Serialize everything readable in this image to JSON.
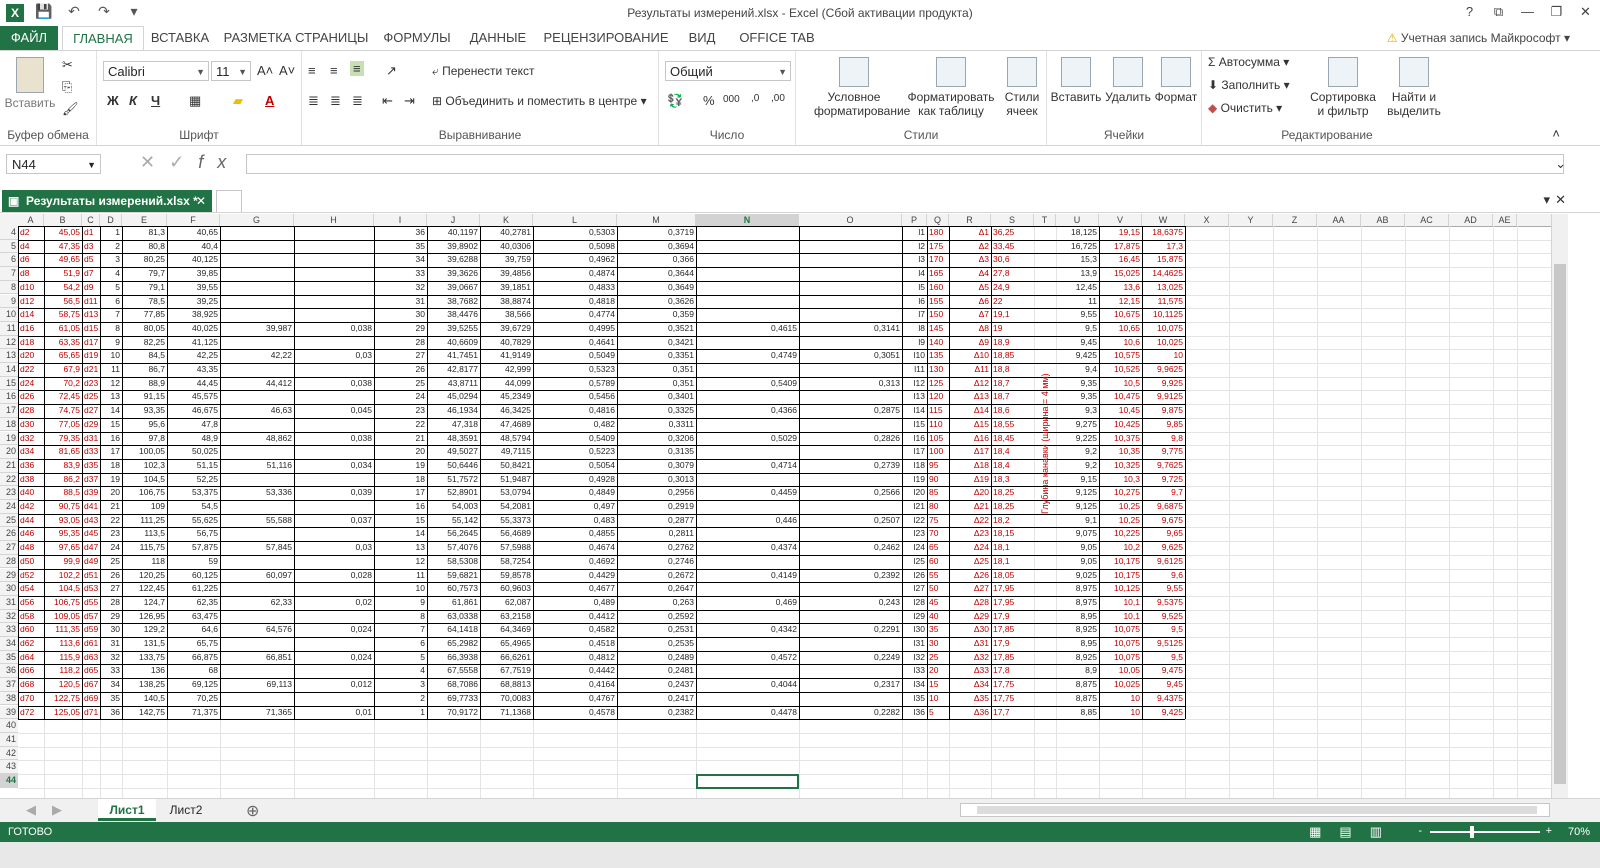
{
  "window": {
    "title": "Результаты измерений.xlsx - Excel (Сбой активации продукта)",
    "app_icon": "X",
    "help": "?",
    "controls": [
      "⧉",
      "—",
      "❐",
      "✕"
    ]
  },
  "qat": [
    "💾",
    "↶",
    "↷",
    "▾"
  ],
  "tabs": {
    "file": "ФАЙЛ",
    "items": [
      "ГЛАВНАЯ",
      "ВСТАВКА",
      "РАЗМЕТКА СТРАНИЦЫ",
      "ФОРМУЛЫ",
      "ДАННЫЕ",
      "РЕЦЕНЗИРОВАНИЕ",
      "ВИД",
      "OFFICE TAB"
    ],
    "account": "Учетная запись Майкрософт"
  },
  "ribbon": {
    "clipboard": {
      "label": "Буфер обмена",
      "paste": "Вставить"
    },
    "font": {
      "label": "Шрифт",
      "name": "Calibri",
      "size": "11",
      "bold": "Ж",
      "italic": "К",
      "underline": "Ч"
    },
    "alignment": {
      "label": "Выравнивание",
      "wrap": "Перенести текст",
      "merge": "Объединить и поместить в центре"
    },
    "number": {
      "label": "Число",
      "format": "Общий",
      "percent": "%",
      "thousands": "000"
    },
    "styles": {
      "label": "Стили",
      "cond": "Условное форматирование",
      "table": "Форматировать как таблицу",
      "cell": "Стили ячеек"
    },
    "cells": {
      "label": "Ячейки",
      "insert": "Вставить",
      "delete": "Удалить",
      "format": "Формат"
    },
    "editing": {
      "label": "Редактирование",
      "autosum": "Автосумма",
      "fill": "Заполнить",
      "clear": "Очистить",
      "sort": "Сортировка и фильтр",
      "find": "Найти и выделить"
    }
  },
  "formula": {
    "namebox": "N44",
    "value": ""
  },
  "doc_tab": "Результаты измерений.xlsx *",
  "columns": [
    "A",
    "B",
    "C",
    "D",
    "E",
    "F",
    "G",
    "H",
    "I",
    "J",
    "K",
    "L",
    "M",
    "N",
    "O",
    "P",
    "Q",
    "R",
    "S",
    "T",
    "U",
    "V",
    "W",
    "X",
    "Y",
    "Z",
    "AA",
    "AB",
    "AC",
    "AD",
    "AE"
  ],
  "selected_column": "N",
  "selected_cell": "N44",
  "vertical_label": "Глубина канавки (ширина = 4 мм)",
  "rows": [
    [
      "4",
      "d2",
      "45,05",
      "d1",
      "1",
      "81,3",
      "40,65",
      "",
      "",
      "36",
      "40,1197",
      "40,2781",
      "0,5303",
      "0,3719",
      "",
      "",
      "l1",
      "180",
      "Δ1",
      "36,25",
      "",
      "18,125",
      "19,15",
      "18,6375"
    ],
    [
      "5",
      "d4",
      "47,35",
      "d3",
      "2",
      "80,8",
      "40,4",
      "",
      "",
      "35",
      "39,8902",
      "40,0306",
      "0,5098",
      "0,3694",
      "",
      "",
      "l2",
      "175",
      "Δ2",
      "33,45",
      "",
      "16,725",
      "17,875",
      "17,3"
    ],
    [
      "6",
      "d6",
      "49,65",
      "d5",
      "3",
      "80,25",
      "40,125",
      "",
      "",
      "34",
      "39,6288",
      "39,759",
      "0,4962",
      "0,366",
      "",
      "",
      "l3",
      "170",
      "Δ3",
      "30,6",
      "",
      "15,3",
      "16,45",
      "15,875"
    ],
    [
      "7",
      "d8",
      "51,9",
      "d7",
      "4",
      "79,7",
      "39,85",
      "",
      "",
      "33",
      "39,3626",
      "39,4856",
      "0,4874",
      "0,3644",
      "",
      "",
      "l4",
      "165",
      "Δ4",
      "27,8",
      "",
      "13,9",
      "15,025",
      "14,4625"
    ],
    [
      "8",
      "d10",
      "54,2",
      "d9",
      "5",
      "79,1",
      "39,55",
      "",
      "",
      "32",
      "39,0667",
      "39,1851",
      "0,4833",
      "0,3649",
      "",
      "",
      "l5",
      "160",
      "Δ5",
      "24,9",
      "",
      "12,45",
      "13,6",
      "13,025"
    ],
    [
      "9",
      "d12",
      "56,5",
      "d11",
      "6",
      "78,5",
      "39,25",
      "",
      "",
      "31",
      "38,7682",
      "38,8874",
      "0,4818",
      "0,3626",
      "",
      "",
      "l6",
      "155",
      "Δ6",
      "22",
      "",
      "11",
      "12,15",
      "11,575"
    ],
    [
      "10",
      "d14",
      "58,75",
      "d13",
      "7",
      "77,85",
      "38,925",
      "",
      "",
      "30",
      "38,4476",
      "38,566",
      "0,4774",
      "0,359",
      "",
      "",
      "l7",
      "150",
      "Δ7",
      "19,1",
      "",
      "9,55",
      "10,675",
      "10,1125"
    ],
    [
      "11",
      "d16",
      "61,05",
      "d15",
      "8",
      "80,05",
      "40,025",
      "39,987",
      "0,038",
      "29",
      "39,5255",
      "39,6729",
      "0,4995",
      "0,3521",
      "0,4615",
      "0,3141",
      "l8",
      "145",
      "Δ8",
      "19",
      "",
      "9,5",
      "10,65",
      "10,075"
    ],
    [
      "12",
      "d18",
      "63,35",
      "d17",
      "9",
      "82,25",
      "41,125",
      "",
      "",
      "28",
      "40,6609",
      "40,7829",
      "0,4641",
      "0,3421",
      "",
      "",
      "l9",
      "140",
      "Δ9",
      "18,9",
      "",
      "9,45",
      "10,6",
      "10,025"
    ],
    [
      "13",
      "d20",
      "65,65",
      "d19",
      "10",
      "84,5",
      "42,25",
      "42,22",
      "0,03",
      "27",
      "41,7451",
      "41,9149",
      "0,5049",
      "0,3351",
      "0,4749",
      "0,3051",
      "l10",
      "135",
      "Δ10",
      "18,85",
      "",
      "9,425",
      "10,575",
      "10"
    ],
    [
      "14",
      "d22",
      "67,9",
      "d21",
      "11",
      "86,7",
      "43,35",
      "",
      "",
      "26",
      "42,8177",
      "42,999",
      "0,5323",
      "0,351",
      "",
      "",
      "l11",
      "130",
      "Δ11",
      "18,8",
      "",
      "9,4",
      "10,525",
      "9,9625"
    ],
    [
      "15",
      "d24",
      "70,2",
      "d23",
      "12",
      "88,9",
      "44,45",
      "44,412",
      "0,038",
      "25",
      "43,8711",
      "44,099",
      "0,5789",
      "0,351",
      "0,5409",
      "0,313",
      "l12",
      "125",
      "Δ12",
      "18,7",
      "",
      "9,35",
      "10,5",
      "9,925"
    ],
    [
      "16",
      "d26",
      "72,45",
      "d25",
      "13",
      "91,15",
      "45,575",
      "",
      "",
      "24",
      "45,0294",
      "45,2349",
      "0,5456",
      "0,3401",
      "",
      "",
      "l13",
      "120",
      "Δ13",
      "18,7",
      "",
      "9,35",
      "10,475",
      "9,9125"
    ],
    [
      "17",
      "d28",
      "74,75",
      "d27",
      "14",
      "93,35",
      "46,675",
      "46,63",
      "0,045",
      "23",
      "46,1934",
      "46,3425",
      "0,4816",
      "0,3325",
      "0,4366",
      "0,2875",
      "l14",
      "115",
      "Δ14",
      "18,6",
      "",
      "9,3",
      "10,45",
      "9,875"
    ],
    [
      "18",
      "d30",
      "77,05",
      "d29",
      "15",
      "95,6",
      "47,8",
      "",
      "",
      "22",
      "47,318",
      "47,4689",
      "0,482",
      "0,3311",
      "",
      "",
      "l15",
      "110",
      "Δ15",
      "18,55",
      "",
      "9,275",
      "10,425",
      "9,85"
    ],
    [
      "19",
      "d32",
      "79,35",
      "d31",
      "16",
      "97,8",
      "48,9",
      "48,862",
      "0,038",
      "21",
      "48,3591",
      "48,5794",
      "0,5409",
      "0,3206",
      "0,5029",
      "0,2826",
      "l16",
      "105",
      "Δ16",
      "18,45",
      "",
      "9,225",
      "10,375",
      "9,8"
    ],
    [
      "20",
      "d34",
      "81,65",
      "d33",
      "17",
      "100,05",
      "50,025",
      "",
      "",
      "20",
      "49,5027",
      "49,7115",
      "0,5223",
      "0,3135",
      "",
      "",
      "l17",
      "100",
      "Δ17",
      "18,4",
      "",
      "9,2",
      "10,35",
      "9,775"
    ],
    [
      "21",
      "d36",
      "83,9",
      "d35",
      "18",
      "102,3",
      "51,15",
      "51,116",
      "0,034",
      "19",
      "50,6446",
      "50,8421",
      "0,5054",
      "0,3079",
      "0,4714",
      "0,2739",
      "l18",
      "95",
      "Δ18",
      "18,4",
      "",
      "9,2",
      "10,325",
      "9,7625"
    ],
    [
      "22",
      "d38",
      "86,2",
      "d37",
      "19",
      "104,5",
      "52,25",
      "",
      "",
      "18",
      "51,7572",
      "51,9487",
      "0,4928",
      "0,3013",
      "",
      "",
      "l19",
      "90",
      "Δ19",
      "18,3",
      "",
      "9,15",
      "10,3",
      "9,725"
    ],
    [
      "23",
      "d40",
      "88,5",
      "d39",
      "20",
      "106,75",
      "53,375",
      "53,336",
      "0,039",
      "17",
      "52,8901",
      "53,0794",
      "0,4849",
      "0,2956",
      "0,4459",
      "0,2566",
      "l20",
      "85",
      "Δ20",
      "18,25",
      "",
      "9,125",
      "10,275",
      "9,7"
    ],
    [
      "24",
      "d42",
      "90,75",
      "d41",
      "21",
      "109",
      "54,5",
      "",
      "",
      "16",
      "54,003",
      "54,2081",
      "0,497",
      "0,2919",
      "",
      "",
      "l21",
      "80",
      "Δ21",
      "18,25",
      "",
      "9,125",
      "10,25",
      "9,6875"
    ],
    [
      "25",
      "d44",
      "93,05",
      "d43",
      "22",
      "111,25",
      "55,625",
      "55,588",
      "0,037",
      "15",
      "55,142",
      "55,3373",
      "0,483",
      "0,2877",
      "0,446",
      "0,2507",
      "l22",
      "75",
      "Δ22",
      "18,2",
      "",
      "9,1",
      "10,25",
      "9,675"
    ],
    [
      "26",
      "d46",
      "95,35",
      "d45",
      "23",
      "113,5",
      "56,75",
      "",
      "",
      "14",
      "56,2645",
      "56,4689",
      "0,4855",
      "0,2811",
      "",
      "",
      "l23",
      "70",
      "Δ23",
      "18,15",
      "",
      "9,075",
      "10,225",
      "9,65"
    ],
    [
      "27",
      "d48",
      "97,65",
      "d47",
      "24",
      "115,75",
      "57,875",
      "57,845",
      "0,03",
      "13",
      "57,4076",
      "57,5988",
      "0,4674",
      "0,2762",
      "0,4374",
      "0,2462",
      "l24",
      "65",
      "Δ24",
      "18,1",
      "",
      "9,05",
      "10,2",
      "9,625"
    ],
    [
      "28",
      "d50",
      "99,9",
      "d49",
      "25",
      "118",
      "59",
      "",
      "",
      "12",
      "58,5308",
      "58,7254",
      "0,4692",
      "0,2746",
      "",
      "",
      "l25",
      "60",
      "Δ25",
      "18,1",
      "",
      "9,05",
      "10,175",
      "9,6125"
    ],
    [
      "29",
      "d52",
      "102,2",
      "d51",
      "26",
      "120,25",
      "60,125",
      "60,097",
      "0,028",
      "11",
      "59,6821",
      "59,8578",
      "0,4429",
      "0,2672",
      "0,4149",
      "0,2392",
      "l26",
      "55",
      "Δ26",
      "18,05",
      "",
      "9,025",
      "10,175",
      "9,6"
    ],
    [
      "30",
      "d54",
      "104,5",
      "d53",
      "27",
      "122,45",
      "61,225",
      "",
      "",
      "10",
      "60,7573",
      "60,9603",
      "0,4677",
      "0,2647",
      "",
      "",
      "l27",
      "50",
      "Δ27",
      "17,95",
      "",
      "8,975",
      "10,125",
      "9,55"
    ],
    [
      "31",
      "d56",
      "106,75",
      "d55",
      "28",
      "124,7",
      "62,35",
      "62,33",
      "0,02",
      "9",
      "61,861",
      "62,087",
      "0,489",
      "0,263",
      "0,469",
      "0,243",
      "l28",
      "45",
      "Δ28",
      "17,95",
      "",
      "8,975",
      "10,1",
      "9,5375"
    ],
    [
      "32",
      "d58",
      "109,05",
      "d57",
      "29",
      "126,95",
      "63,475",
      "",
      "",
      "8",
      "63,0338",
      "63,2158",
      "0,4412",
      "0,2592",
      "",
      "",
      "l29",
      "40",
      "Δ29",
      "17,9",
      "",
      "8,95",
      "10,1",
      "9,525"
    ],
    [
      "33",
      "d60",
      "111,35",
      "d59",
      "30",
      "129,2",
      "64,6",
      "64,576",
      "0,024",
      "7",
      "64,1418",
      "64,3469",
      "0,4582",
      "0,2531",
      "0,4342",
      "0,2291",
      "l30",
      "35",
      "Δ30",
      "17,85",
      "",
      "8,925",
      "10,075",
      "9,5"
    ],
    [
      "34",
      "d62",
      "113,6",
      "d61",
      "31",
      "131,5",
      "65,75",
      "",
      "",
      "6",
      "65,2982",
      "65,4965",
      "0,4518",
      "0,2535",
      "",
      "",
      "l31",
      "30",
      "Δ31",
      "17,9",
      "",
      "8,95",
      "10,075",
      "9,5125"
    ],
    [
      "35",
      "d64",
      "115,9",
      "d63",
      "32",
      "133,75",
      "66,875",
      "66,851",
      "0,024",
      "5",
      "66,3938",
      "66,6261",
      "0,4812",
      "0,2489",
      "0,4572",
      "0,2249",
      "l32",
      "25",
      "Δ32",
      "17,85",
      "",
      "8,925",
      "10,075",
      "9,5"
    ],
    [
      "36",
      "d66",
      "118,2",
      "d65",
      "33",
      "136",
      "68",
      "",
      "",
      "4",
      "67,5558",
      "67,7519",
      "0,4442",
      "0,2481",
      "",
      "",
      "l33",
      "20",
      "Δ33",
      "17,8",
      "",
      "8,9",
      "10,05",
      "9,475"
    ],
    [
      "37",
      "d68",
      "120,5",
      "d67",
      "34",
      "138,25",
      "69,125",
      "69,113",
      "0,012",
      "3",
      "68,7086",
      "68,8813",
      "0,4164",
      "0,2437",
      "0,4044",
      "0,2317",
      "l34",
      "15",
      "Δ34",
      "17,75",
      "",
      "8,875",
      "10,025",
      "9,45"
    ],
    [
      "38",
      "d70",
      "122,75",
      "d69",
      "35",
      "140,5",
      "70,25",
      "",
      "",
      "2",
      "69,7733",
      "70,0083",
      "0,4767",
      "0,2417",
      "",
      "",
      "l35",
      "10",
      "Δ35",
      "17,75",
      "",
      "8,875",
      "10",
      "9,4375"
    ],
    [
      "39",
      "d72",
      "125,05",
      "d71",
      "36",
      "142,75",
      "71,375",
      "71,365",
      "0,01",
      "1",
      "70,9172",
      "71,1368",
      "0,4578",
      "0,2382",
      "0,4478",
      "0,2282",
      "l36",
      "5",
      "Δ36",
      "17,7",
      "",
      "8,85",
      "10",
      "9,425"
    ]
  ],
  "empty_rows": [
    "40",
    "41",
    "42",
    "43",
    "44"
  ],
  "sheets": [
    "Лист1",
    "Лист2"
  ],
  "sheet_add": "⊕",
  "status": {
    "ready": "ГОТОВО",
    "zoom": "70%",
    "minus": "-",
    "plus": "+"
  },
  "colors": {
    "accent": "#217346",
    "red": "#c00000"
  }
}
